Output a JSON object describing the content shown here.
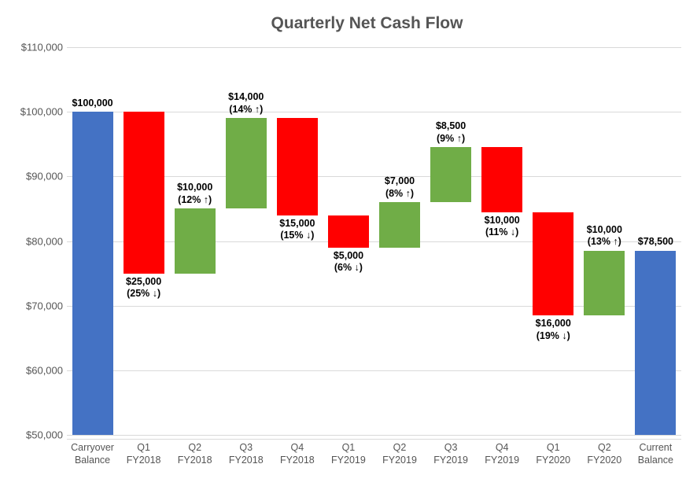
{
  "chart_data": {
    "type": "waterfall",
    "title": "Quarterly Net Cash Flow",
    "ylabel": "",
    "xlabel": "",
    "ylim": [
      50000,
      110000
    ],
    "y_ticks": [
      "$50,000",
      "$60,000",
      "$70,000",
      "$80,000",
      "$90,000",
      "$100,000",
      "$110,000"
    ],
    "y_tick_values": [
      50000,
      60000,
      70000,
      80000,
      90000,
      100000,
      110000
    ],
    "categories": [
      "Carryover Balance",
      "Q1 FY2018",
      "Q2 FY2018",
      "Q3 FY2018",
      "Q4 FY2018",
      "Q1 FY2019",
      "Q2 FY2019",
      "Q3 FY2019",
      "Q4 FY2019",
      "Q1 FY2020",
      "Q2 FY2020",
      "Current Balance"
    ],
    "bars": [
      {
        "kind": "total",
        "bottom": 50000,
        "top": 100000,
        "color": "blue",
        "label_lines": [
          "$100,000"
        ],
        "label_pos": "above"
      },
      {
        "kind": "decrease",
        "bottom": 75000,
        "top": 100000,
        "color": "red",
        "value": -25000,
        "pct_label": "25% ↓",
        "label_lines": [
          "$25,000",
          "(25% ↓)"
        ],
        "label_pos": "below"
      },
      {
        "kind": "increase",
        "bottom": 75000,
        "top": 85000,
        "color": "green",
        "value": 10000,
        "pct_label": "12% ↑",
        "label_lines": [
          "$10,000",
          "(12% ↑)"
        ],
        "label_pos": "above"
      },
      {
        "kind": "increase",
        "bottom": 85000,
        "top": 99000,
        "color": "green",
        "value": 14000,
        "pct_label": "14% ↑",
        "label_lines": [
          "$14,000",
          "(14% ↑)"
        ],
        "label_pos": "above"
      },
      {
        "kind": "decrease",
        "bottom": 84000,
        "top": 99000,
        "color": "red",
        "value": -15000,
        "pct_label": "15% ↓",
        "label_lines": [
          "$15,000",
          "(15% ↓)"
        ],
        "label_pos": "below"
      },
      {
        "kind": "decrease",
        "bottom": 79000,
        "top": 84000,
        "color": "red",
        "value": -5000,
        "pct_label": "6% ↓",
        "label_lines": [
          "$5,000",
          "(6% ↓)"
        ],
        "label_pos": "below"
      },
      {
        "kind": "increase",
        "bottom": 79000,
        "top": 86000,
        "color": "green",
        "value": 7000,
        "pct_label": "8% ↑",
        "label_lines": [
          "$7,000",
          "(8% ↑)"
        ],
        "label_pos": "above"
      },
      {
        "kind": "increase",
        "bottom": 86000,
        "top": 94500,
        "color": "green",
        "value": 8500,
        "pct_label": "9% ↑",
        "label_lines": [
          "$8,500",
          "(9% ↑)"
        ],
        "label_pos": "above"
      },
      {
        "kind": "decrease",
        "bottom": 84500,
        "top": 94500,
        "color": "red",
        "value": -10000,
        "pct_label": "11% ↓",
        "label_lines": [
          "$10,000",
          "(11% ↓)"
        ],
        "label_pos": "below"
      },
      {
        "kind": "decrease",
        "bottom": 68500,
        "top": 84500,
        "color": "red",
        "value": -16000,
        "pct_label": "19% ↓",
        "label_lines": [
          "$16,000",
          "(19% ↓)"
        ],
        "label_pos": "below"
      },
      {
        "kind": "increase",
        "bottom": 68500,
        "top": 78500,
        "color": "green",
        "value": 10000,
        "pct_label": "13% ↑",
        "label_lines": [
          "$10,000",
          "(13% ↑)"
        ],
        "label_pos": "above"
      },
      {
        "kind": "total",
        "bottom": 50000,
        "top": 78500,
        "color": "blue",
        "label_lines": [
          "$78,500"
        ],
        "label_pos": "above"
      }
    ]
  }
}
